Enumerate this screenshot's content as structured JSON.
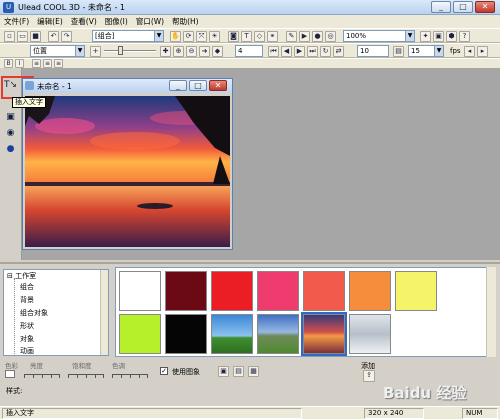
{
  "window": {
    "title": "Ulead COOL 3D - 未命名 - 1",
    "minimize": "_",
    "maximize": "□",
    "close": "✕"
  },
  "menu": [
    "文件(F)",
    "编辑(E)",
    "查看(V)",
    "图像(I)",
    "窗口(W)",
    "帮助(H)"
  ],
  "toolbar1": {
    "object_combo": "[组合]",
    "zoom_combo": "100%"
  },
  "toolbar2": {
    "mode_combo": "位置",
    "frame_value": "4",
    "fps_value": "10",
    "frame_total": "15",
    "fps_label": "fps"
  },
  "left_tools": {
    "tooltip": "插入文字"
  },
  "document": {
    "title": "未命名 - 1"
  },
  "tree": {
    "root": "工作室",
    "items": [
      "组合",
      "背景",
      "组合对象",
      "形状",
      "对象",
      "动画"
    ]
  },
  "sliders": {
    "labels": [
      "色彩",
      "亮度",
      "饱和度",
      "色调"
    ]
  },
  "options": {
    "use_image": "使用图象",
    "add_label": "添加",
    "style_label": "样式:"
  },
  "swatch_colors": [
    "#ffffff",
    "#6b0a14",
    "#ea1e24",
    "#ee3c6e",
    "#f25a4b",
    "#f48e3c",
    "#f4f36a",
    "#b6f02a",
    "#050505"
  ],
  "statusbar": {
    "message": "插入文字",
    "size": "320 x 240",
    "mode": "NUM"
  },
  "watermark": "Baidu 经验"
}
